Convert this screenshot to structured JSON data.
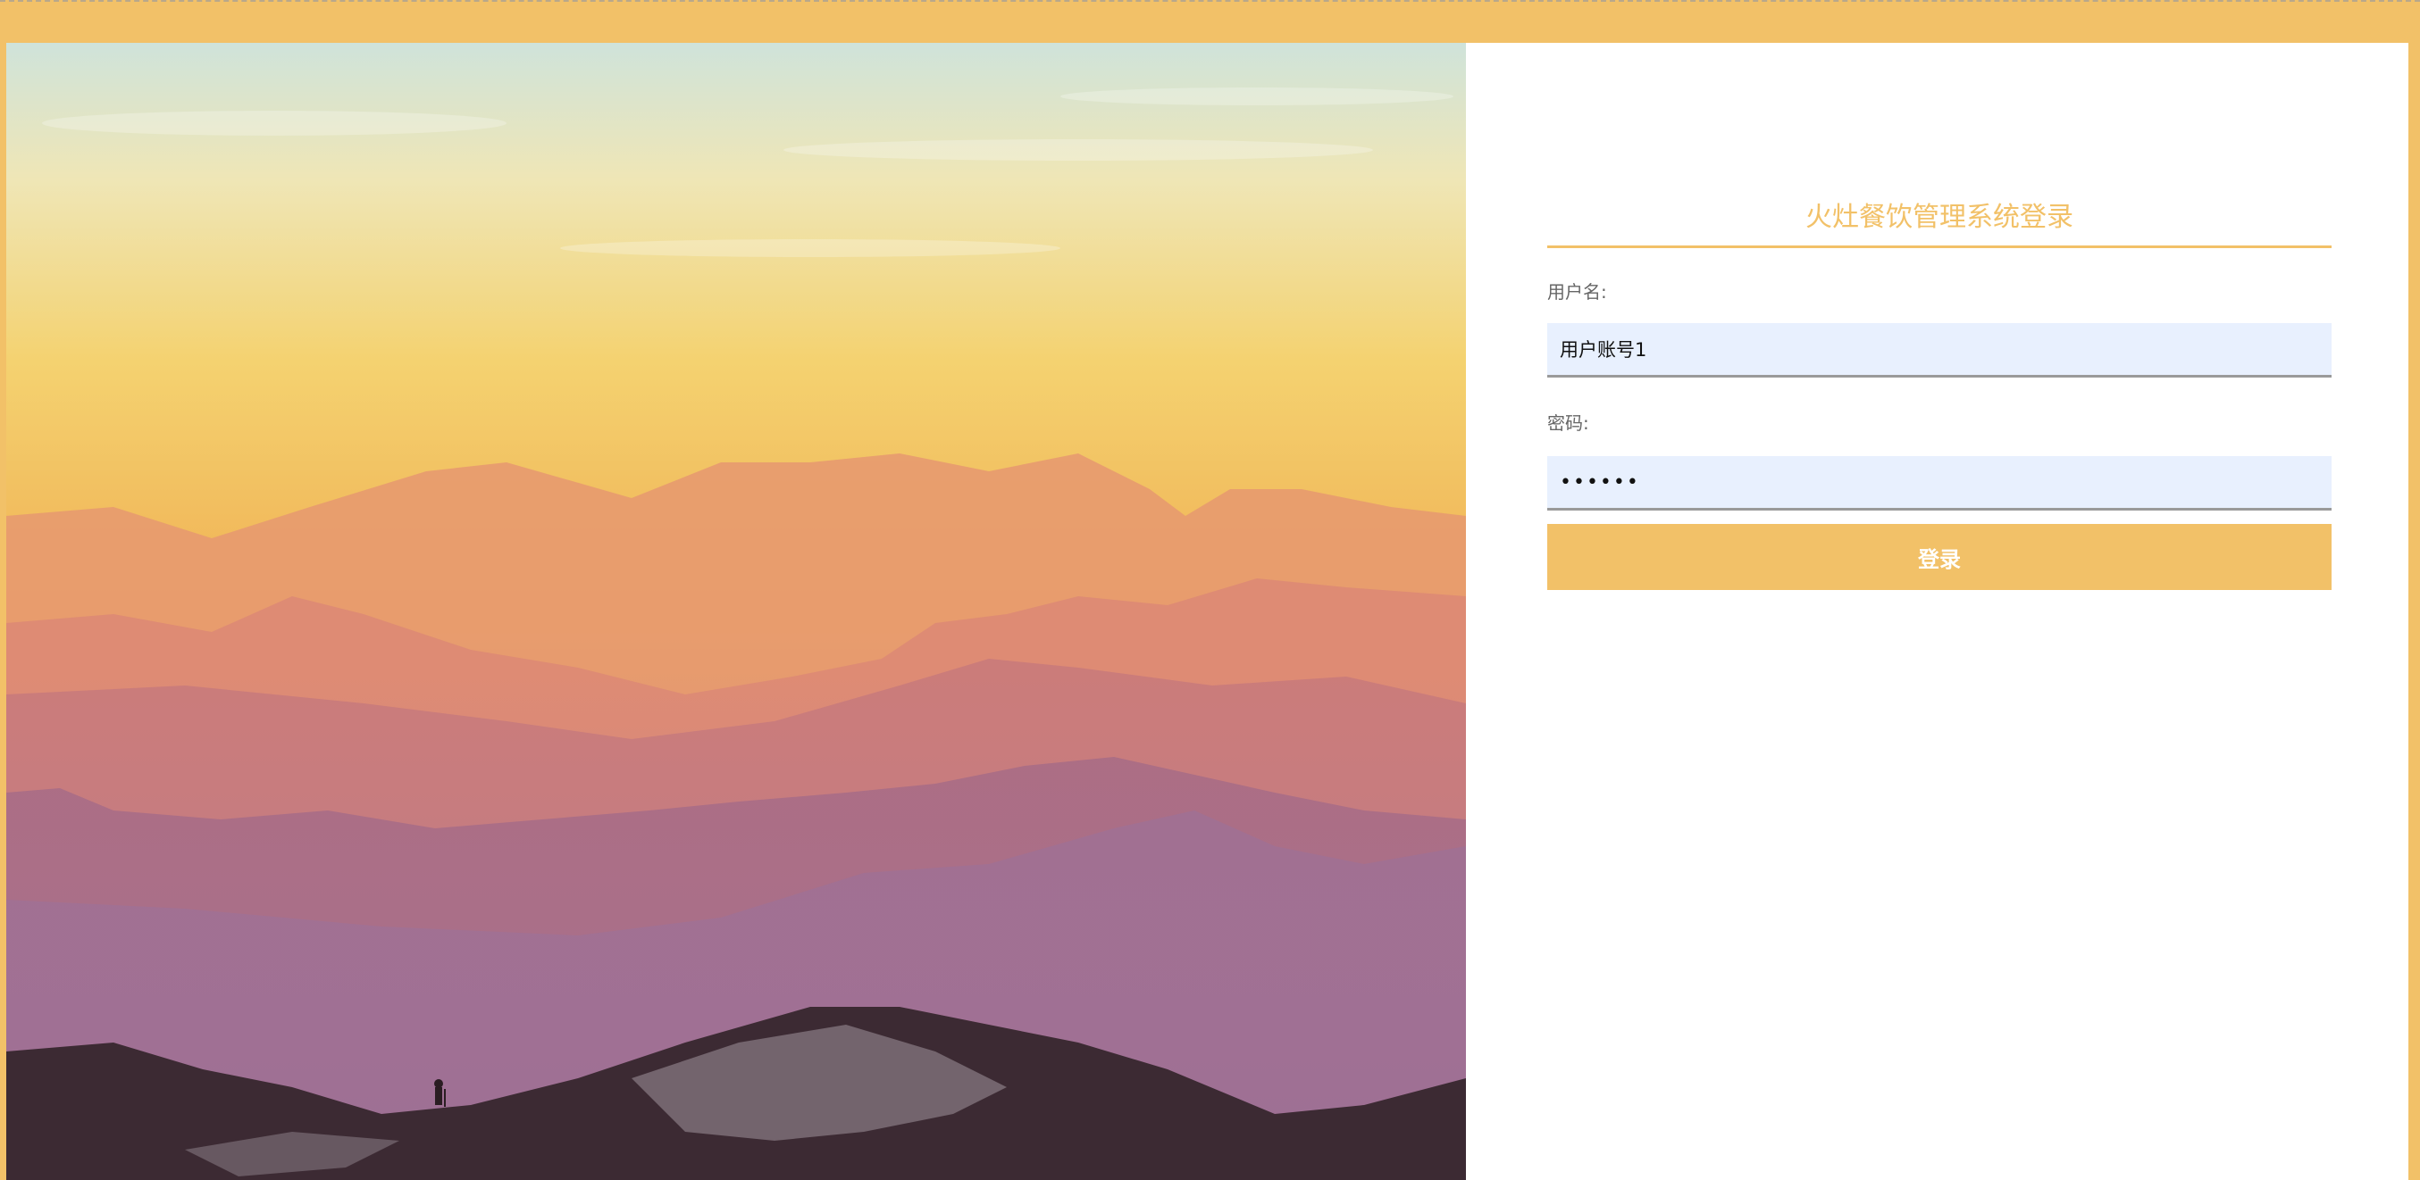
{
  "login": {
    "title": "火灶餐饮管理系统登录",
    "username_label": "用户名:",
    "username_value": "用户账号1",
    "password_label": "密码:",
    "password_value": "123456",
    "submit_label": "登录"
  },
  "hero": {
    "image": "mountain-sunset-landscape"
  },
  "colors": {
    "accent": "#f2c168",
    "input_bg": "#e8f0fe",
    "label_text": "#666666"
  }
}
